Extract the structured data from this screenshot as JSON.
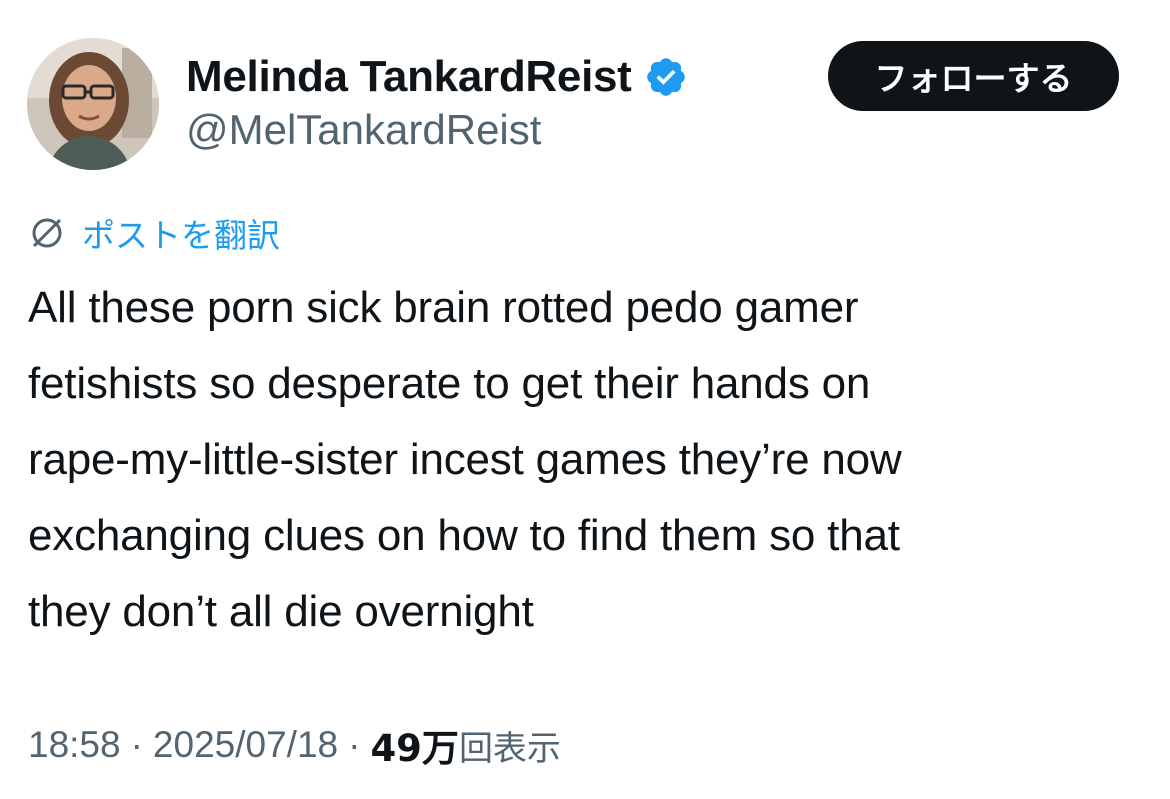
{
  "author": {
    "display_name": "Melinda TankardReist",
    "handle": "@MelTankardReist",
    "verified": true
  },
  "follow_button": {
    "label": "フォローする"
  },
  "translate_link": {
    "label": "ポストを翻訳",
    "icon": "globe-slash-icon"
  },
  "tweet": {
    "lines": [
      "All these porn sick brain rotted pedo gamer",
      "fetishists so desperate to get their hands on",
      "rape-my-little-sister incest games they’re now",
      "exchanging clues on how to find them so that",
      "they don’t all die overnight"
    ]
  },
  "meta": {
    "time": "18:58",
    "separator": "·",
    "date": "2025/07/18",
    "views_count": "49万",
    "views_label": "回表示"
  },
  "colors": {
    "text_primary": "#0f1419",
    "text_secondary": "#536471",
    "link": "#1d9bf0",
    "verified_badge": "#1d9bf0",
    "button_bg": "#0f1419",
    "button_text": "#ffffff"
  }
}
